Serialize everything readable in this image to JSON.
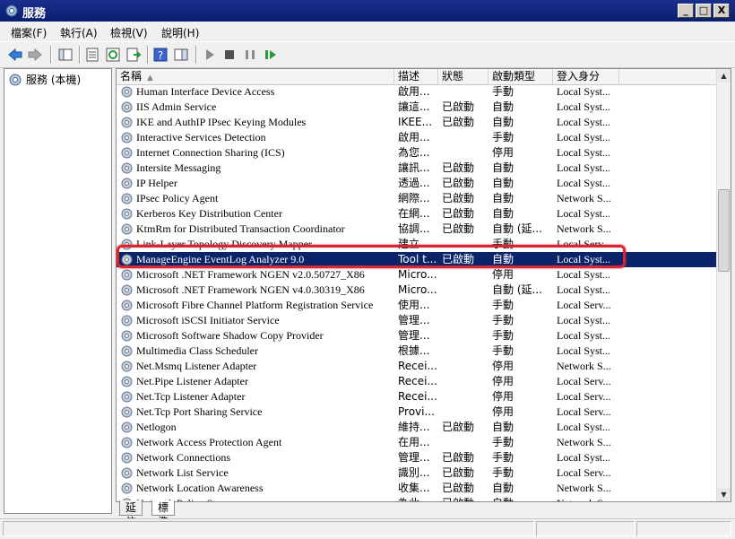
{
  "window": {
    "title": "服務",
    "min": "_",
    "max": "□",
    "close": "X"
  },
  "menu": [
    {
      "label": "檔案(F)"
    },
    {
      "label": "執行(A)"
    },
    {
      "label": "檢視(V)"
    },
    {
      "label": "說明(H)"
    }
  ],
  "tree": {
    "root": "服務 (本機)"
  },
  "columns": {
    "name": "名稱",
    "desc": "描述",
    "status": "狀態",
    "startup": "啟動類型",
    "logon": "登入身分"
  },
  "rows": [
    {
      "name": "Human Interface Device Access",
      "desc": "啟用...",
      "status": "",
      "startup": "手動",
      "logon": "Local Syst..."
    },
    {
      "name": "IIS Admin Service",
      "desc": "讓這...",
      "status": "已啟動",
      "startup": "自動",
      "logon": "Local Syst..."
    },
    {
      "name": "IKE and AuthIP IPsec Keying Modules",
      "desc": "IKEE...",
      "status": "已啟動",
      "startup": "自動",
      "logon": "Local Syst..."
    },
    {
      "name": "Interactive Services Detection",
      "desc": "啟用...",
      "status": "",
      "startup": "手動",
      "logon": "Local Syst..."
    },
    {
      "name": "Internet Connection Sharing (ICS)",
      "desc": "為您...",
      "status": "",
      "startup": "停用",
      "logon": "Local Syst..."
    },
    {
      "name": "Intersite Messaging",
      "desc": "讓訊...",
      "status": "已啟動",
      "startup": "自動",
      "logon": "Local Syst..."
    },
    {
      "name": "IP Helper",
      "desc": "透過...",
      "status": "已啟動",
      "startup": "自動",
      "logon": "Local Syst..."
    },
    {
      "name": "IPsec Policy Agent",
      "desc": "網際...",
      "status": "已啟動",
      "startup": "自動",
      "logon": "Network S..."
    },
    {
      "name": "Kerberos Key Distribution Center",
      "desc": "在網...",
      "status": "已啟動",
      "startup": "自動",
      "logon": "Local Syst..."
    },
    {
      "name": "KtmRm for Distributed Transaction Coordinator",
      "desc": "協調...",
      "status": "已啟動",
      "startup": "自動 (延...",
      "logon": "Network S..."
    },
    {
      "name": "Link-Layer Topology Discovery Mapper",
      "desc": "建立...",
      "status": "",
      "startup": "手動",
      "logon": "Local Serv..."
    },
    {
      "name": "ManageEngine EventLog Analyzer 9.0",
      "desc": "Tool t...",
      "status": "已啟動",
      "startup": "自動",
      "logon": "Local Syst...",
      "selected": true
    },
    {
      "name": "Microsoft .NET Framework NGEN v2.0.50727_X86",
      "desc": "Micro...",
      "status": "",
      "startup": "停用",
      "logon": "Local Syst..."
    },
    {
      "name": "Microsoft .NET Framework NGEN v4.0.30319_X86",
      "desc": "Micro...",
      "status": "",
      "startup": "自動 (延...",
      "logon": "Local Syst..."
    },
    {
      "name": "Microsoft Fibre Channel Platform Registration Service",
      "desc": "使用...",
      "status": "",
      "startup": "手動",
      "logon": "Local Serv..."
    },
    {
      "name": "Microsoft iSCSI Initiator Service",
      "desc": "管理...",
      "status": "",
      "startup": "手動",
      "logon": "Local Syst..."
    },
    {
      "name": "Microsoft Software Shadow Copy Provider",
      "desc": "管理...",
      "status": "",
      "startup": "手動",
      "logon": "Local Syst..."
    },
    {
      "name": "Multimedia Class Scheduler",
      "desc": "根據...",
      "status": "",
      "startup": "手動",
      "logon": "Local Syst..."
    },
    {
      "name": "Net.Msmq Listener Adapter",
      "desc": "Recei...",
      "status": "",
      "startup": "停用",
      "logon": "Network S..."
    },
    {
      "name": "Net.Pipe Listener Adapter",
      "desc": "Recei...",
      "status": "",
      "startup": "停用",
      "logon": "Local Serv..."
    },
    {
      "name": "Net.Tcp Listener Adapter",
      "desc": "Recei...",
      "status": "",
      "startup": "停用",
      "logon": "Local Serv..."
    },
    {
      "name": "Net.Tcp Port Sharing Service",
      "desc": "Provi...",
      "status": "",
      "startup": "停用",
      "logon": "Local Serv..."
    },
    {
      "name": "Netlogon",
      "desc": "維持...",
      "status": "已啟動",
      "startup": "自動",
      "logon": "Local Syst..."
    },
    {
      "name": "Network Access Protection Agent",
      "desc": "在用...",
      "status": "",
      "startup": "手動",
      "logon": "Network S..."
    },
    {
      "name": "Network Connections",
      "desc": "管理...",
      "status": "已啟動",
      "startup": "手動",
      "logon": "Local Syst..."
    },
    {
      "name": "Network List Service",
      "desc": "識別...",
      "status": "已啟動",
      "startup": "手動",
      "logon": "Local Serv..."
    },
    {
      "name": "Network Location Awareness",
      "desc": "收集...",
      "status": "已啟動",
      "startup": "自動",
      "logon": "Network S..."
    },
    {
      "name": "Network Policy Server",
      "desc": "為此...",
      "status": "已啟動",
      "startup": "自動",
      "logon": "Network S..."
    }
  ],
  "tabs": [
    {
      "label": "延伸"
    },
    {
      "label": "標準"
    }
  ],
  "colors": {
    "selection": "#0a246a",
    "highlight_box": "#d9262f",
    "titlebar": "#0a1f6e"
  }
}
